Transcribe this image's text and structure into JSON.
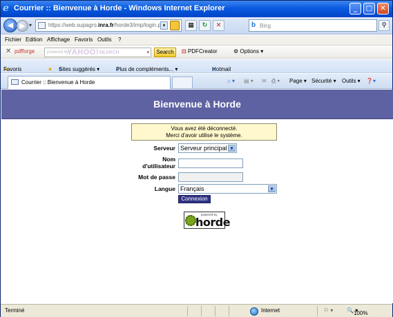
{
  "window": {
    "title": "Courrier :: Bienvenue à Horde - Windows Internet Explorer",
    "controls": {
      "minimize": "_",
      "maximize": "□",
      "close": "✕"
    }
  },
  "addressbar": {
    "back_icon": "back-arrow-icon",
    "url_prefix": "https://web.supagro.",
    "url_domain": "inra.fr",
    "url_rest": "/horde3/imp/login.php?",
    "search_placeholder": "Bing"
  },
  "menubar": [
    "Fichier",
    "Edition",
    "Affichage",
    "Favoris",
    "Outils",
    "?"
  ],
  "yahoo_toolbar": {
    "close": "✕",
    "pdfforge": "pdfforge",
    "search_powered": "powered by",
    "search_brand": "YAHOO!",
    "search_word": "SEARCH",
    "search_button": "Search",
    "pdfcreator": "PDFCreator",
    "options": "Options ▾"
  },
  "favorites_bar": {
    "favoris": "Favoris",
    "suggested": "Sites suggérés ▾",
    "more_addons": "Plus de compléments... ▾",
    "hotmail": "Hotmail"
  },
  "tabs": [
    {
      "label": "Courrier :: Bienvenue à Horde"
    }
  ],
  "commandbar": {
    "page": "Page ▾",
    "securite": "Sécurité ▾",
    "outils": "Outils ▾"
  },
  "page": {
    "header": "Bienvenue à Horde",
    "notice_line1": "Vous avez été déconnecté.",
    "notice_line2": "Merci d'avoir utilisé le système.",
    "form": {
      "server_label": "Serveur",
      "server_value": "Serveur principal",
      "username_label_1": "Nom",
      "username_label_2": "d'utilisateur",
      "username_value": "",
      "password_label": "Mot de passe",
      "password_value": "",
      "language_label": "Langue",
      "language_value": "Français",
      "submit_label": "Connexion"
    },
    "logo": {
      "powered_by": "powered by",
      "word": "horde"
    }
  },
  "statusbar": {
    "status": "Terminé",
    "zone": "Internet",
    "zoom": "100%"
  }
}
